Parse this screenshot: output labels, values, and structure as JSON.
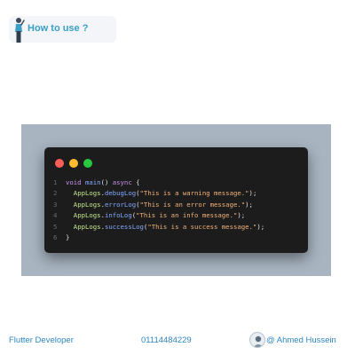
{
  "header": {
    "how_to_use": "How to use ?",
    "figure_icon": "person-pointing-icon"
  },
  "window": {
    "controls": [
      "close",
      "minimize",
      "maximize"
    ],
    "colors": {
      "close": "#ff5f57",
      "minimize": "#febc2e",
      "maximize": "#28c840"
    },
    "code_lines": [
      {
        "n": "1",
        "text": "void main() async {"
      },
      {
        "n": "2",
        "text": "  AppLogs.debugLog(\"This is a warning message.\");"
      },
      {
        "n": "3",
        "text": "  AppLogs.errorLog(\"This is an error message.\");"
      },
      {
        "n": "4",
        "text": "  AppLogs.infoLog(\"This is an info message.\");"
      },
      {
        "n": "5",
        "text": "  AppLogs.successLog(\"This is a success message.\");"
      },
      {
        "n": "6",
        "text": "}"
      }
    ]
  },
  "footer": {
    "role": "Flutter Developer",
    "phone": "01114484229",
    "author": "@ Ahmed Hussein",
    "avatar_icon": "avatar-icon"
  },
  "colors": {
    "accent": "#2e86c1",
    "code_bg": "#1c1c1c",
    "panel_bg": "#a8b5c1"
  }
}
